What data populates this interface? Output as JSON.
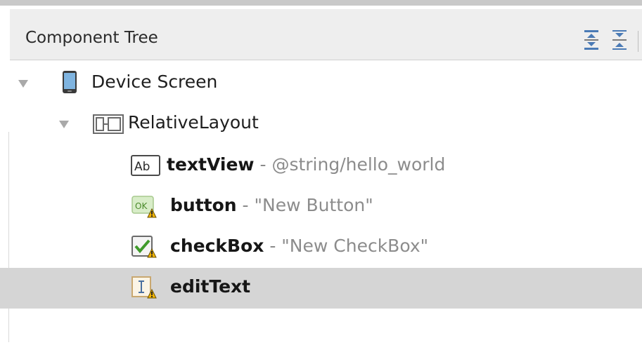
{
  "panel": {
    "title": "Component Tree",
    "actions": [
      {
        "name": "expand-all-icon"
      },
      {
        "name": "collapse-all-icon"
      }
    ]
  },
  "tree": {
    "nodes": [
      {
        "label": "Device Screen",
        "icon": "device-screen-icon",
        "expanded": true,
        "level": 0
      },
      {
        "label": "RelativeLayout",
        "icon": "relative-layout-icon",
        "expanded": true,
        "level": 1
      },
      {
        "name": "textView",
        "separator": " - ",
        "detail": "@string/hello_world",
        "icon": "textview-icon",
        "level": 2,
        "warning": false
      },
      {
        "name": "button",
        "separator": " - ",
        "detail": "\"New Button\"",
        "icon": "button-icon",
        "level": 2,
        "warning": true
      },
      {
        "name": "checkBox",
        "separator": " - ",
        "detail": "\"New CheckBox\"",
        "icon": "checkbox-icon",
        "level": 2,
        "warning": true
      },
      {
        "name": "editText",
        "separator": "",
        "detail": "",
        "icon": "edittext-icon",
        "level": 2,
        "warning": true,
        "selected": true
      }
    ]
  },
  "colors": {
    "header_bg": "#eeeeee",
    "selected_bg": "#d5d5d5",
    "detail_text": "#8c8c8c",
    "warning": "#f2b400"
  }
}
